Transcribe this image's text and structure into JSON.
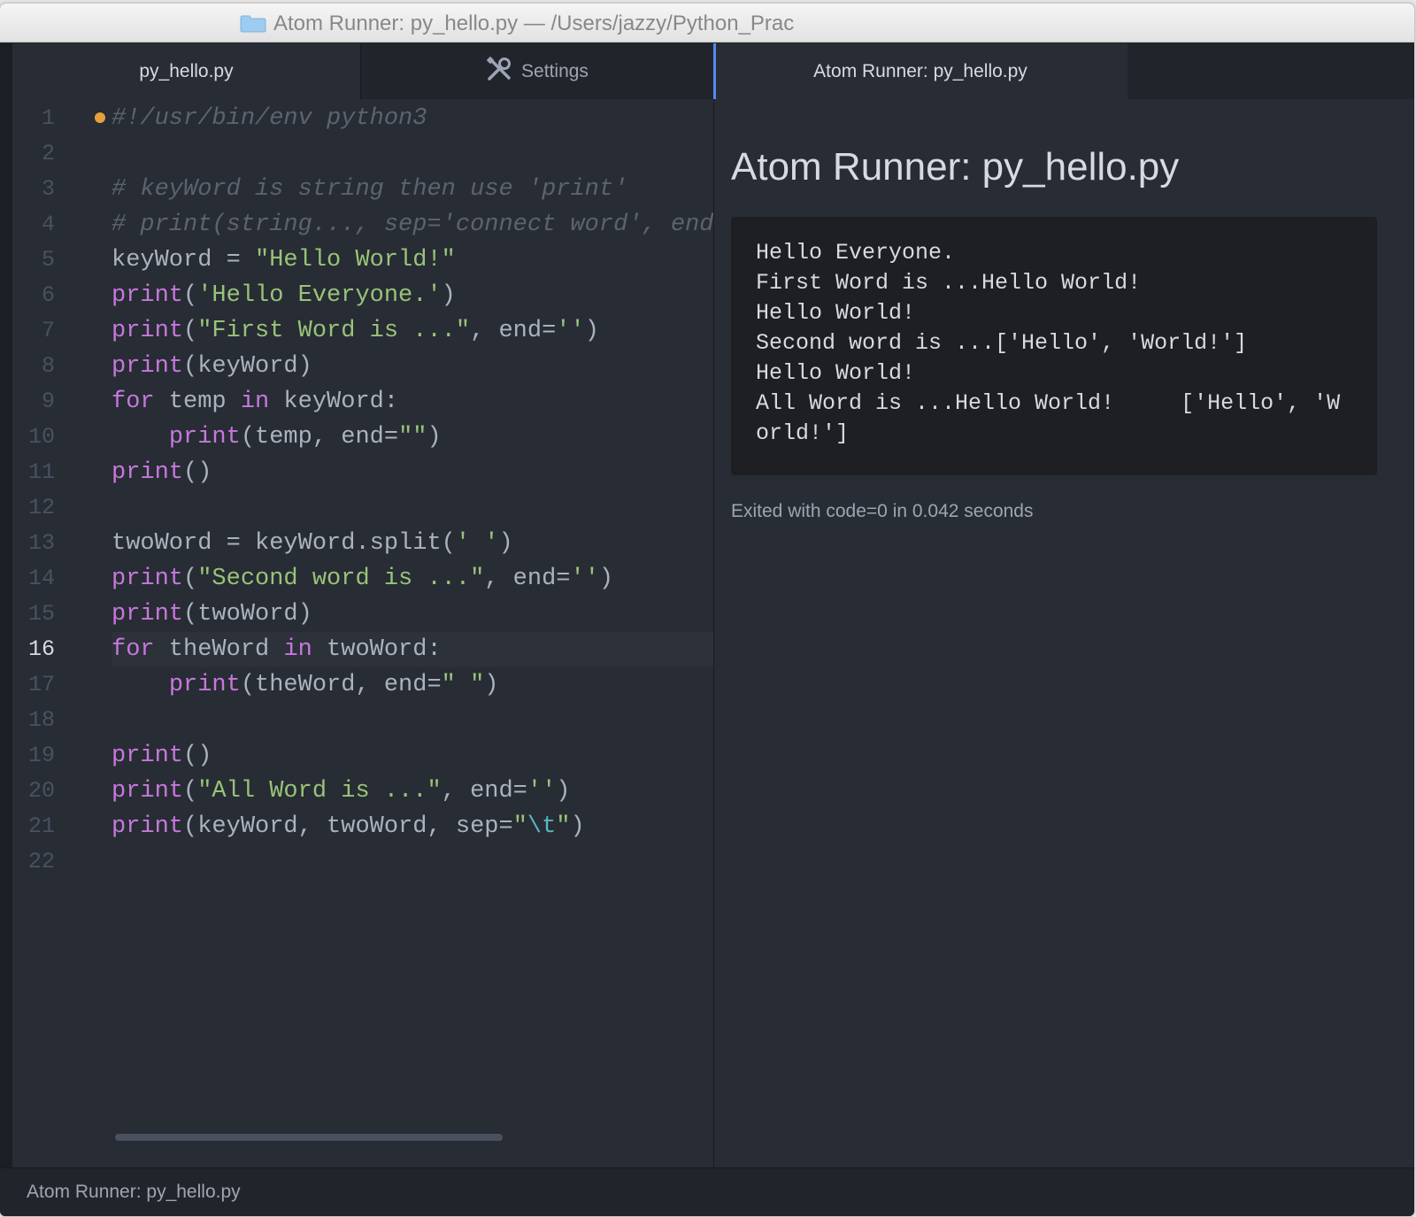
{
  "window": {
    "title": "Atom Runner: py_hello.py — /Users/jazzy/Python_Prac"
  },
  "tabs": {
    "left": [
      {
        "label": "py_hello.py",
        "active": true
      },
      {
        "label": "Settings",
        "active": false,
        "icon": "tools-icon"
      }
    ],
    "right": [
      {
        "label": "Atom Runner: py_hello.py",
        "active": true
      }
    ]
  },
  "editor": {
    "current_line": 16,
    "line_numbers": [
      "1",
      "2",
      "3",
      "4",
      "5",
      "6",
      "7",
      "8",
      "9",
      "10",
      "11",
      "12",
      "13",
      "14",
      "15",
      "16",
      "17",
      "18",
      "19",
      "20",
      "21",
      "22"
    ],
    "lines": [
      [
        {
          "t": "comment",
          "s": "#!/usr/bin/env python3"
        }
      ],
      [],
      [
        {
          "t": "comment",
          "s": "# keyWord is string then use 'print'"
        }
      ],
      [
        {
          "t": "comment",
          "s": "# print(string..., sep='connect word', end"
        }
      ],
      [
        {
          "t": "plain",
          "s": "keyWord = "
        },
        {
          "t": "string",
          "s": "\"Hello World!\""
        }
      ],
      [
        {
          "t": "keyword",
          "s": "print"
        },
        {
          "t": "plain",
          "s": "("
        },
        {
          "t": "string",
          "s": "'Hello Everyone.'"
        },
        {
          "t": "plain",
          "s": ")"
        }
      ],
      [
        {
          "t": "keyword",
          "s": "print"
        },
        {
          "t": "plain",
          "s": "("
        },
        {
          "t": "string",
          "s": "\"First Word is ...\""
        },
        {
          "t": "plain",
          "s": ", end="
        },
        {
          "t": "string",
          "s": "''"
        },
        {
          "t": "plain",
          "s": ")"
        }
      ],
      [
        {
          "t": "keyword",
          "s": "print"
        },
        {
          "t": "plain",
          "s": "(keyWord)"
        }
      ],
      [
        {
          "t": "keyword",
          "s": "for"
        },
        {
          "t": "plain",
          "s": " temp "
        },
        {
          "t": "keyword",
          "s": "in"
        },
        {
          "t": "plain",
          "s": " keyWord:"
        }
      ],
      [
        {
          "t": "plain",
          "s": "    "
        },
        {
          "t": "keyword",
          "s": "print"
        },
        {
          "t": "plain",
          "s": "(temp, end="
        },
        {
          "t": "string",
          "s": "\"\""
        },
        {
          "t": "plain",
          "s": ")"
        }
      ],
      [
        {
          "t": "keyword",
          "s": "print"
        },
        {
          "t": "plain",
          "s": "()"
        }
      ],
      [],
      [
        {
          "t": "plain",
          "s": "twoWord = keyWord.split("
        },
        {
          "t": "string",
          "s": "' '"
        },
        {
          "t": "plain",
          "s": ")"
        }
      ],
      [
        {
          "t": "keyword",
          "s": "print"
        },
        {
          "t": "plain",
          "s": "("
        },
        {
          "t": "string",
          "s": "\"Second word is ...\""
        },
        {
          "t": "plain",
          "s": ", end="
        },
        {
          "t": "string",
          "s": "''"
        },
        {
          "t": "plain",
          "s": ")"
        }
      ],
      [
        {
          "t": "keyword",
          "s": "print"
        },
        {
          "t": "plain",
          "s": "(twoWord)"
        }
      ],
      [
        {
          "t": "keyword",
          "s": "for"
        },
        {
          "t": "plain",
          "s": " theWord "
        },
        {
          "t": "keyword",
          "s": "in"
        },
        {
          "t": "plain",
          "s": " twoWord:"
        }
      ],
      [
        {
          "t": "plain",
          "s": "    "
        },
        {
          "t": "keyword",
          "s": "print"
        },
        {
          "t": "plain",
          "s": "(theWord, end="
        },
        {
          "t": "string",
          "s": "\" \""
        },
        {
          "t": "plain",
          "s": ")"
        }
      ],
      [],
      [
        {
          "t": "keyword",
          "s": "print"
        },
        {
          "t": "plain",
          "s": "()"
        }
      ],
      [
        {
          "t": "keyword",
          "s": "print"
        },
        {
          "t": "plain",
          "s": "("
        },
        {
          "t": "string",
          "s": "\"All Word is ...\""
        },
        {
          "t": "plain",
          "s": ", end="
        },
        {
          "t": "string",
          "s": "''"
        },
        {
          "t": "plain",
          "s": ")"
        }
      ],
      [
        {
          "t": "keyword",
          "s": "print"
        },
        {
          "t": "plain",
          "s": "(keyWord, twoWord, sep="
        },
        {
          "t": "string",
          "s": "\""
        },
        {
          "t": "escape",
          "s": "\\t"
        },
        {
          "t": "string",
          "s": "\""
        },
        {
          "t": "plain",
          "s": ")"
        }
      ],
      []
    ]
  },
  "runner": {
    "heading": "Atom Runner: py_hello.py",
    "output_lines": [
      "Hello Everyone.",
      "First Word is ...Hello World!",
      "Hello World!",
      "Second word is ...['Hello', 'World!']",
      "Hello World!",
      "All Word is ...Hello World!     ['Hello', 'W",
      "orld!']"
    ],
    "exit_message": "Exited with code=0 in 0.042 seconds"
  },
  "statusbar": {
    "text": "Atom Runner: py_hello.py"
  },
  "colors": {
    "accent": "#568af2",
    "modified": "#e5a03c",
    "keyword": "#c678dd",
    "string": "#98c379",
    "comment": "#5c6370"
  }
}
